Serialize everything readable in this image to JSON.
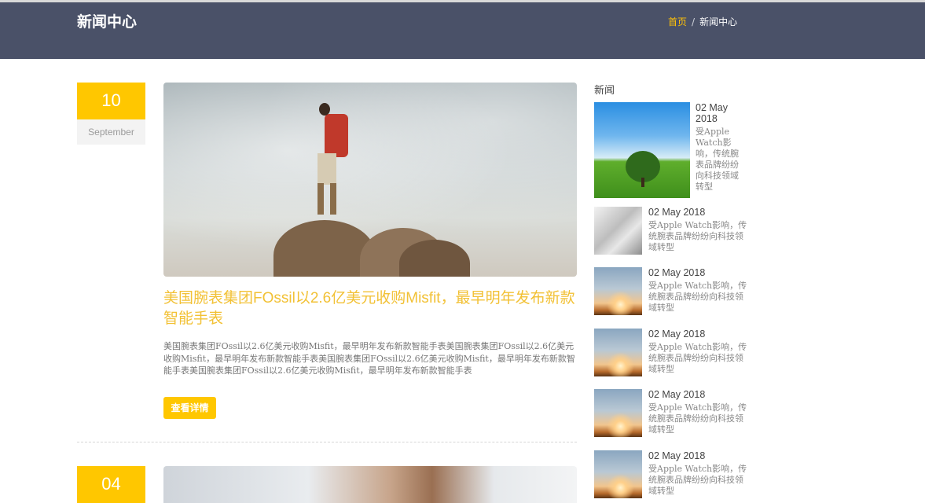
{
  "header": {
    "title": "新闻中心",
    "breadcrumb": {
      "home": "首页",
      "separator": "/",
      "current": "新闻中心"
    }
  },
  "posts": [
    {
      "day": "10",
      "month": "September",
      "image": "hiker-on-rock-photo",
      "title": "美国腕表集团FOssil以2.6亿美元收购Misfit，最早明年发布新款智能手表",
      "excerpt": "美国腕表集团FOssil以2.6亿美元收购Misfit，最早明年发布新款智能手表美国腕表集团FOssil以2.6亿美元收购Misfit，最早明年发布新款智能手表美国腕表集团FOssil以2.6亿美元收购Misfit，最早明年发布新款智能手表美国腕表集团FOssil以2.6亿美元收购Misfit，最早明年发布新款智能手表",
      "button": "查看详情"
    },
    {
      "day": "04",
      "image": "woman-portrait-photo"
    }
  ],
  "sidebar": {
    "title": "新闻",
    "items": [
      {
        "date": "02 May 2018",
        "desc": "受Apple Watch影响，传统腕表品牌纷纷向科技领域转型",
        "thumb": "green-field-tree"
      },
      {
        "date": "02 May 2018",
        "desc": "受Apple Watch影响，传统腕表品牌纷纷向科技领域转型",
        "thumb": "bw-woman"
      },
      {
        "date": "02 May 2018",
        "desc": "受Apple Watch影响，传统腕表品牌纷纷向科技领域转型",
        "thumb": "sunset-sky"
      },
      {
        "date": "02 May 2018",
        "desc": "受Apple Watch影响，传统腕表品牌纷纷向科技领域转型",
        "thumb": "sunset-sky"
      },
      {
        "date": "02 May 2018",
        "desc": "受Apple Watch影响，传统腕表品牌纷纷向科技领域转型",
        "thumb": "sunset-sky"
      },
      {
        "date": "02 May 2018",
        "desc": "受Apple Watch影响，传统腕表品牌纷纷向科技领域转型",
        "thumb": "sunset-sky"
      }
    ]
  },
  "colors": {
    "header_bg": "#4a5168",
    "accent": "#ffc700",
    "title": "#f2c135"
  }
}
